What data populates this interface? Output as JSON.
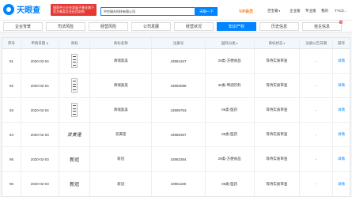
{
  "header": {
    "logo_text": "天眼查",
    "gov_badge": "国家中小企业发展子基金旗下 官方备案企业征信机构",
    "search_value": "中京瑞东科技有限公司",
    "search_button": "天眼一下",
    "vip_label": "VIP会员",
    "nav_items": [
      "百宝箱",
      "企业版",
      "专业版",
      "我的"
    ],
    "user": "TYC0..."
  },
  "tabs": [
    {
      "label": "企业背景",
      "badge": ""
    },
    {
      "label": "司法风险",
      "badge": ""
    },
    {
      "label": "经营风险",
      "badge": ""
    },
    {
      "label": "公司发展",
      "badge": ""
    },
    {
      "label": "经营状况",
      "badge": ""
    },
    {
      "label": "知识产权",
      "badge": ""
    },
    {
      "label": "历史信息",
      "badge": ""
    },
    {
      "label": "自主信息",
      "badge": "8"
    }
  ],
  "table": {
    "headers": [
      "序号",
      "申请日期",
      "商标",
      "商标名称",
      "注册号",
      "国际分类",
      "商标状态",
      "注册公告日期",
      "操作"
    ],
    "rows": [
      {
        "no": "91",
        "date": "2020-02-04",
        "mark_type": "tall",
        "mark_text": "",
        "name": "清瑞奥美",
        "reg_no": "43994167",
        "class": "29类-方便食品",
        "status": "等待实质审查",
        "pub_date": "-",
        "action": "详情"
      },
      {
        "no": "92",
        "date": "2020-02-04",
        "mark_type": "tall",
        "mark_text": "",
        "name": "清瑞奥美",
        "reg_no": "43993088",
        "class": "30类-啤酒饮料",
        "status": "等待实质审查",
        "pub_date": "-",
        "action": "详情"
      },
      {
        "no": "93",
        "date": "2020-02-04",
        "mark_type": "tall",
        "mark_text": "",
        "name": "清瑞奥美",
        "reg_no": "43995753",
        "class": "05类-医药",
        "status": "等待实质审查",
        "pub_date": "-",
        "action": "详情"
      },
      {
        "no": "94",
        "date": "2020-02-03",
        "mark_type": "callig",
        "mark_text": "双黄莲",
        "name": "双黄莲",
        "reg_no": "43986397",
        "class": "05类-医药",
        "status": "等待实质审查",
        "pub_date": "-",
        "action": "详情"
      },
      {
        "no": "95",
        "date": "2020-02-03",
        "mark_type": "text",
        "mark_text": "新冠",
        "name": "新冠",
        "reg_no": "43983364",
        "class": "29类-方便食品",
        "status": "等待实质审查",
        "pub_date": "-",
        "action": "详情"
      },
      {
        "no": "96",
        "date": "2020-02-03",
        "mark_type": "text",
        "mark_text": "新冠",
        "name": "新冠",
        "reg_no": "43961180",
        "class": "05类-医药",
        "status": "等待实质审查",
        "pub_date": "-",
        "action": "详情"
      }
    ]
  },
  "colors": {
    "brand": "#0084ff",
    "vip": "#ff7a1a",
    "badge": "#e53a33"
  }
}
